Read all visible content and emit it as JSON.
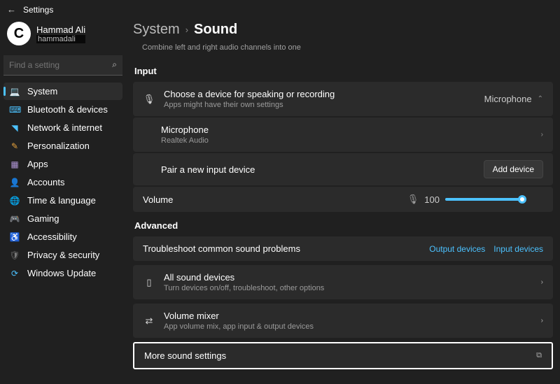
{
  "window": {
    "title": "Settings"
  },
  "profile": {
    "name": "Hammad Ali",
    "username": "hammadali",
    "avatar_letter": "C"
  },
  "search": {
    "placeholder": "Find a setting"
  },
  "nav": [
    {
      "label": "System"
    },
    {
      "label": "Bluetooth & devices"
    },
    {
      "label": "Network & internet"
    },
    {
      "label": "Personalization"
    },
    {
      "label": "Apps"
    },
    {
      "label": "Accounts"
    },
    {
      "label": "Time & language"
    },
    {
      "label": "Gaming"
    },
    {
      "label": "Accessibility"
    },
    {
      "label": "Privacy & security"
    },
    {
      "label": "Windows Update"
    }
  ],
  "breadcrumb": {
    "parent": "System",
    "current": "Sound"
  },
  "mono": {
    "caption": "Combine left and right audio channels into one"
  },
  "sections": {
    "input_head": "Input",
    "advanced_head": "Advanced"
  },
  "input": {
    "choose_title": "Choose a device for speaking or recording",
    "choose_desc": "Apps might have their own settings",
    "choose_value": "Microphone",
    "device_title": "Microphone",
    "device_desc": "Realtek Audio",
    "pair_title": "Pair a new input device",
    "pair_button": "Add device",
    "volume_label": "Volume",
    "volume_value": "100"
  },
  "troubleshoot": {
    "title": "Troubleshoot common sound problems",
    "link_output": "Output devices",
    "link_input": "Input devices"
  },
  "all_devices": {
    "title": "All sound devices",
    "desc": "Turn devices on/off, troubleshoot, other options"
  },
  "mixer": {
    "title": "Volume mixer",
    "desc": "App volume mix, app input & output devices"
  },
  "more": {
    "title": "More sound settings"
  }
}
